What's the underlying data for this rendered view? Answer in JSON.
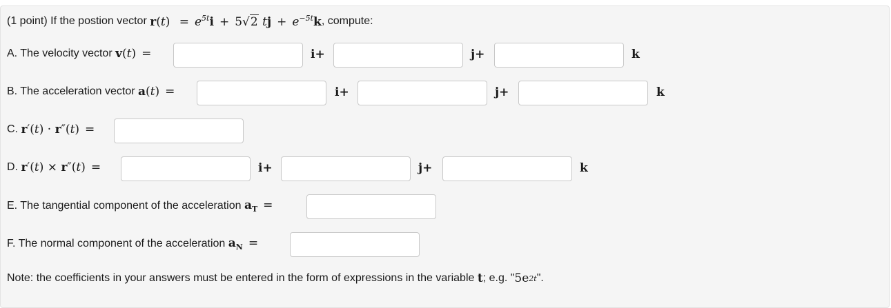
{
  "problem": {
    "intro": "(1 point) If the postion vector",
    "vector_name": "r",
    "t": "t",
    "eq": "=",
    "e": "e",
    "exp1": "5t",
    "plus": "+",
    "coef2": "5",
    "sqrt2": "2",
    "exp3": "−5t",
    "i": "i",
    "j": "j",
    "k": "k",
    "tail": ", compute:"
  },
  "parts": {
    "a": {
      "label": "A. The velocity vector",
      "sym": "v"
    },
    "b": {
      "label": "B. The acceleration vector",
      "sym": "a"
    },
    "c": {
      "label": "C."
    },
    "d": {
      "label": "D."
    },
    "e": {
      "label": "E. The tangential component of the acceleration",
      "sym": "a",
      "sub": "T"
    },
    "f": {
      "label": "F. The normal component of the acceleration",
      "sym": "a",
      "sub": "N"
    }
  },
  "units": {
    "i": "i+",
    "j": "j+",
    "k": "k"
  },
  "note": {
    "text": "Note: the coefficients in your answers must be entered in the form of expressions in the variable",
    "var": "t",
    "eg": "; e.g. \"",
    "coef": "5e",
    "exp": "2t",
    "end": "\"."
  },
  "answers": {
    "a_i": "",
    "a_j": "",
    "a_k": "",
    "b_i": "",
    "b_j": "",
    "b_k": "",
    "c": "",
    "d_i": "",
    "d_j": "",
    "d_k": "",
    "e": "",
    "f": ""
  },
  "colors": {
    "panel": "#f5f5f5",
    "border": "#c8c8c8",
    "text": "#1a1a1a"
  }
}
